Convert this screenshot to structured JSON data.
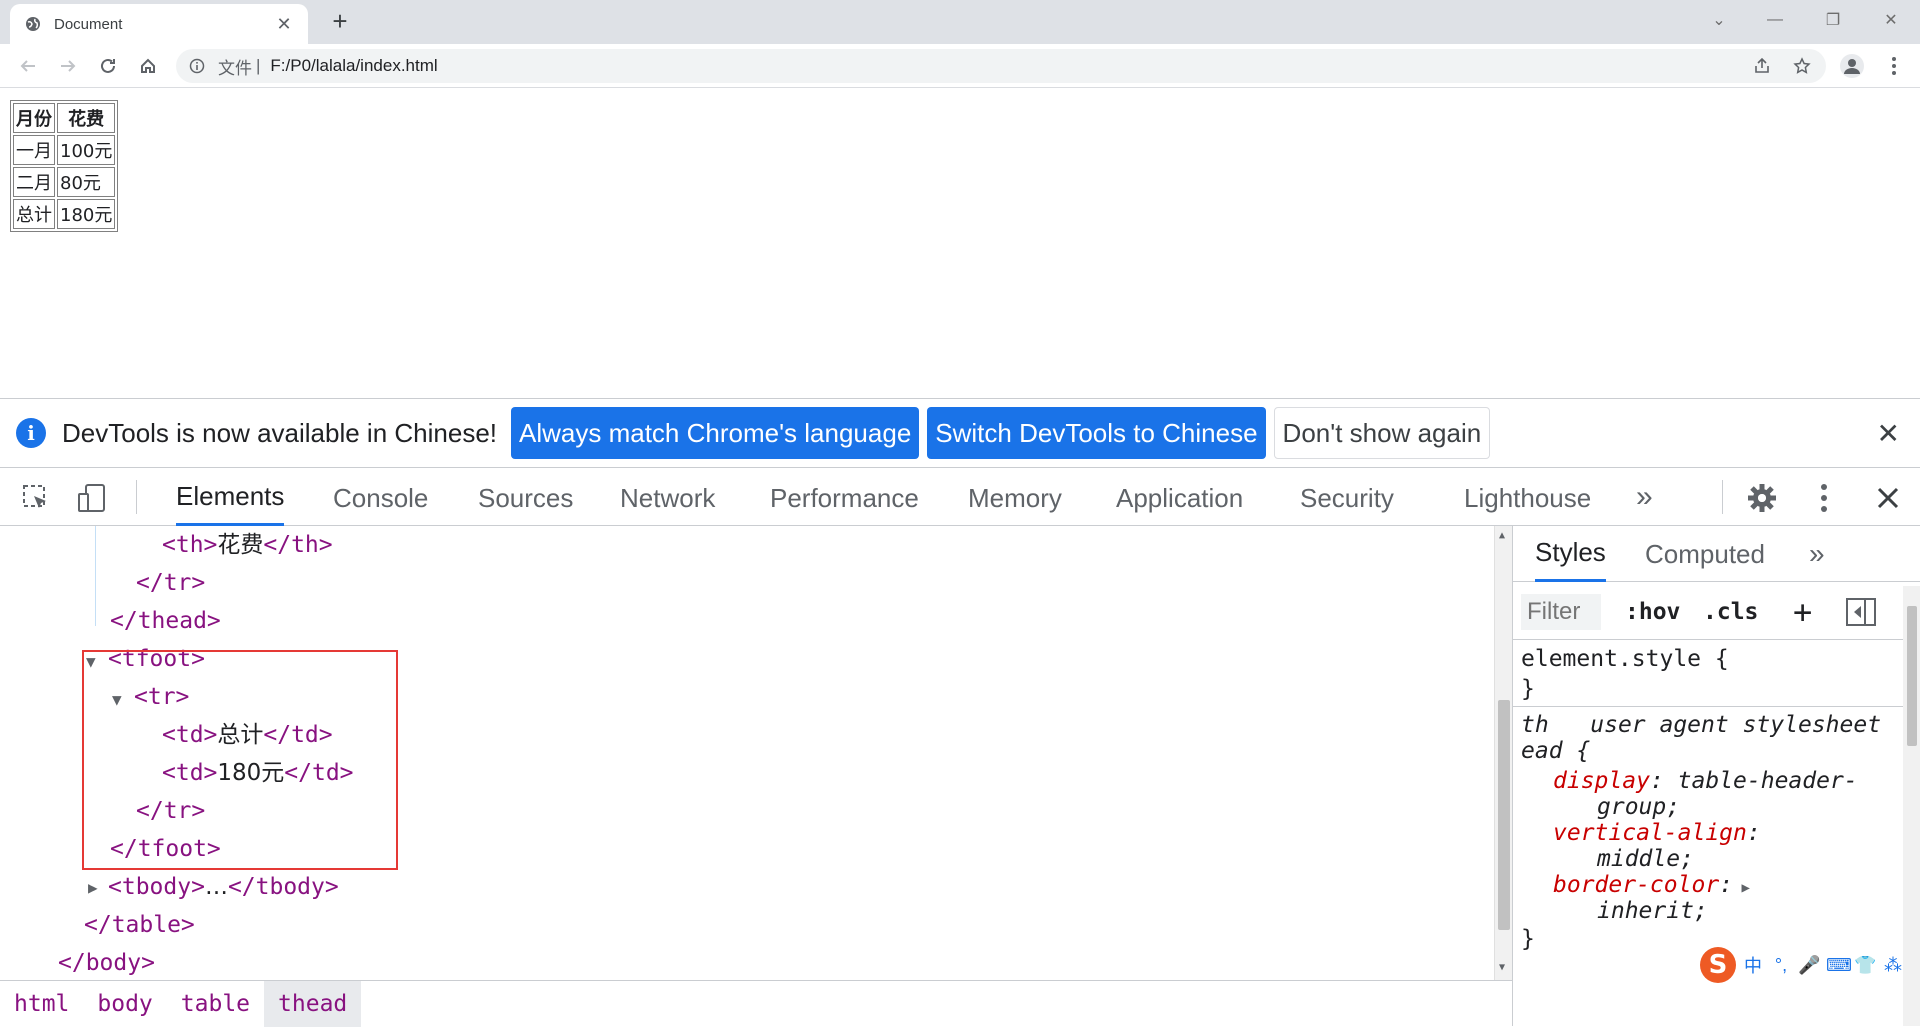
{
  "browser": {
    "tab_title": "Document",
    "tab_close": "✕",
    "new_tab": "+",
    "omnibox": {
      "scheme_label": "文件",
      "separator": "|",
      "url": "F:/P0/lalala/index.html"
    },
    "window_controls": [
      "⌄",
      "—",
      "❐",
      "✕"
    ]
  },
  "page": {
    "headers": [
      "月份",
      "花费"
    ],
    "rows": [
      [
        "一月",
        "100元"
      ],
      [
        "二月",
        "80元"
      ],
      [
        "总计",
        "180元"
      ]
    ]
  },
  "infobar": {
    "message": "DevTools is now available in Chinese!",
    "btn_match": "Always match Chrome's language",
    "btn_switch": "Switch DevTools to Chinese",
    "btn_dismiss": "Don't show again",
    "close": "✕"
  },
  "devtools": {
    "tabs": [
      "Elements",
      "Console",
      "Sources",
      "Network",
      "Performance",
      "Memory",
      "Application",
      "Security",
      "Lighthouse"
    ],
    "more": "»",
    "dom": {
      "l1_open": "<th>",
      "l1_text": "花费",
      "l1_close": "</th>",
      "l2": "</tr>",
      "l3": "</thead>",
      "l4": "<tfoot>",
      "l5": "<tr>",
      "l6_open": "<td>",
      "l6_text": "总计",
      "l6_close": "</td>",
      "l7_open": "<td>",
      "l7_text": "180元",
      "l7_close": "</td>",
      "l8": "</tr>",
      "l9": "</tfoot>",
      "l10_open": "<tbody>",
      "l10_ellipsis": "…",
      "l10_close": "</tbody>",
      "l11": "</table>",
      "l12": "</body>"
    },
    "breadcrumbs": [
      "html",
      "body",
      "table",
      "thead"
    ],
    "styles": {
      "tabs": [
        "Styles",
        "Computed"
      ],
      "more": "»",
      "filter_placeholder": "Filter",
      "hov": ":hov",
      "cls": ".cls",
      "plus": "+",
      "element_style": "element.style {",
      "close_brace": "}",
      "ua_selector_1": "th",
      "ua_label": "user agent stylesheet",
      "ua_selector_2": "ead {",
      "p1_name": "display",
      "p1_value_a": " table-header-",
      "p1_value_b": "group;",
      "p2_name": "vertical-align",
      "p2_value": "middle;",
      "p3_name": "border-color",
      "p3_value": "inherit;",
      "colon": ":"
    },
    "ime": {
      "logo": "S",
      "items": [
        "中",
        "°,",
        "🎤",
        "⌨",
        "👕",
        "⁂"
      ]
    }
  }
}
